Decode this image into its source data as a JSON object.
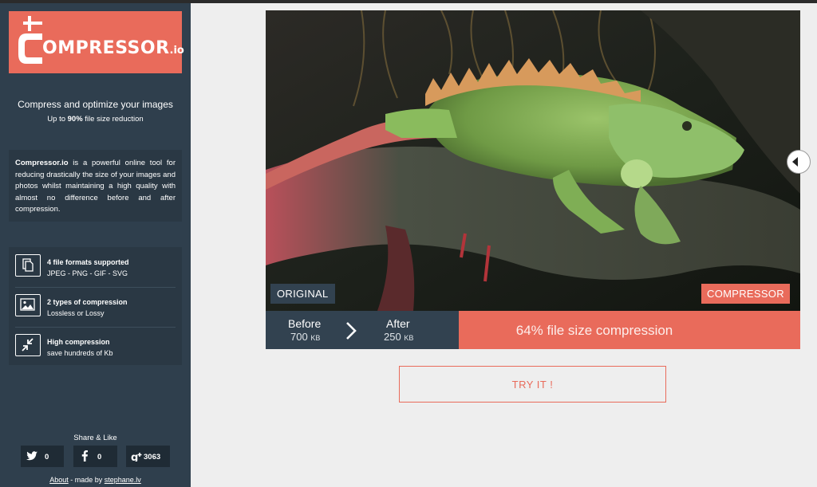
{
  "sidebar": {
    "logo_text": "OMPRESSOR",
    "logo_suffix": ".io",
    "tagline": "Compress and optimize your images",
    "subtagline_pre": "Up to ",
    "subtagline_bold": "90%",
    "subtagline_post": " file size reduction",
    "description_bold": "Compressor.io",
    "description_rest": " is a powerful online tool for reducing drastically the size of your images and photos whilst maintaining a high quality with almost no difference before and after compression.",
    "features": [
      {
        "title": "4 file formats supported",
        "subtitle": "JPEG - PNG - GIF - SVG",
        "icon": "files-icon"
      },
      {
        "title": "2 types of compression",
        "subtitle": "Lossless or Lossy",
        "icon": "image-icon"
      },
      {
        "title": "High compression",
        "subtitle": "save hundreds of Kb",
        "icon": "compress-arrows-icon"
      }
    ],
    "share_title": "Share & Like",
    "share": [
      {
        "icon": "twitter-icon",
        "count": "0"
      },
      {
        "icon": "facebook-icon",
        "count": "0"
      },
      {
        "icon": "google-plus-icon",
        "count": "3063"
      }
    ],
    "footer_link": "About",
    "footer_middle": " - made by ",
    "footer_author": "stephane.lv"
  },
  "main": {
    "badge_original": "ORIGINAL",
    "badge_compressor": "COMPRESSOR",
    "before_label": "Before",
    "before_value": "700",
    "after_label": "After",
    "after_value": "250",
    "size_unit": "KB",
    "compression_text": "64% file size compression",
    "try_button": "TRY IT !"
  },
  "colors": {
    "accent": "#e96b5b",
    "sidebar_bg": "#2f3f4d",
    "panel_bg": "#2a3844",
    "stats_dark": "#324250",
    "page_bg": "#eeeeee"
  }
}
